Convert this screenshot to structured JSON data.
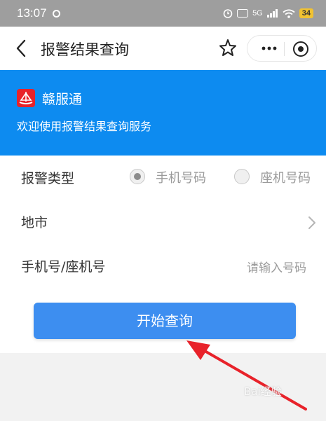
{
  "status_bar": {
    "time": "13:07",
    "network": "5G",
    "battery": "34"
  },
  "nav": {
    "title": "报警结果查询"
  },
  "banner": {
    "brand": "赣服通",
    "welcome": "欢迎使用报警结果查询服务"
  },
  "form": {
    "type_label": "报警类型",
    "radio_options": [
      "手机号码",
      "座机号码"
    ],
    "selected_option": "手机号码",
    "city_label": "地市",
    "number_label": "手机号/座机号",
    "number_placeholder": "请输入号码"
  },
  "button": {
    "query_label": "开始查询"
  },
  "watermark": {
    "text": "Bai经验"
  },
  "colors": {
    "banner": "#0d8bf0",
    "button": "#3d8ef0",
    "annotation_arrow": "#e8222a"
  }
}
